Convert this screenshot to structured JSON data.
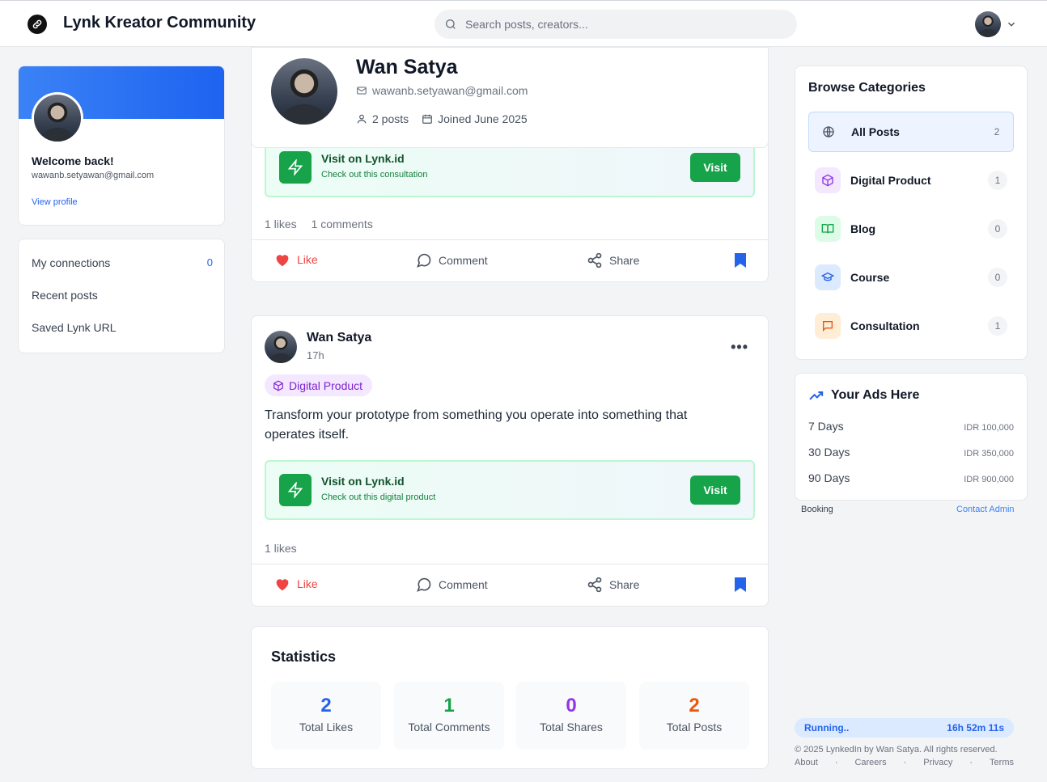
{
  "header": {
    "app_title": "Lynk Kreator Community",
    "search_placeholder": "Search posts, creators..."
  },
  "sidebar": {
    "welcome": "Welcome back!",
    "email": "wawanb.setyawan@gmail.com",
    "view_profile": "View profile",
    "links": [
      {
        "label": "My connections",
        "count": "0"
      },
      {
        "label": "Recent posts"
      },
      {
        "label": "Saved Lynk URL"
      }
    ]
  },
  "profile": {
    "name": "Wan Satya",
    "email": "wawanb.setyawan@gmail.com",
    "posts": "2 posts",
    "joined": "Joined June 2025"
  },
  "posts": [
    {
      "lynk_title": "Visit on Lynk.id",
      "lynk_sub": "Check out this consultation",
      "visit": "Visit",
      "likes": "1 likes",
      "comments": "1 comments"
    },
    {
      "author": "Wan Satya",
      "time": "17h",
      "category": "Digital Product",
      "text": "Transform your prototype from something you operate into something that operates itself.",
      "lynk_title": "Visit on Lynk.id",
      "lynk_sub": "Check out this digital product",
      "visit": "Visit",
      "likes": "1 likes"
    }
  ],
  "actions": {
    "like": "Like",
    "comment": "Comment",
    "share": "Share"
  },
  "statistics": {
    "title": "Statistics",
    "items": [
      {
        "value": "2",
        "label": "Total Likes",
        "color": "#2563eb"
      },
      {
        "value": "1",
        "label": "Total Comments",
        "color": "#16a34a"
      },
      {
        "value": "0",
        "label": "Total Shares",
        "color": "#9333ea"
      },
      {
        "value": "2",
        "label": "Total Posts",
        "color": "#ea580c"
      }
    ]
  },
  "categories": {
    "title": "Browse Categories",
    "items": [
      {
        "label": "All Posts",
        "count": "2",
        "icon": "globe-icon"
      },
      {
        "label": "Digital Product",
        "count": "1",
        "icon": "box-icon"
      },
      {
        "label": "Blog",
        "count": "0",
        "icon": "book-icon"
      },
      {
        "label": "Course",
        "count": "0",
        "icon": "graduation-cap-icon"
      },
      {
        "label": "Consultation",
        "count": "1",
        "icon": "message-square-icon"
      }
    ]
  },
  "ads": {
    "title": "Your Ads Here",
    "rows": [
      {
        "duration": "7 Days",
        "price": "IDR 100,000"
      },
      {
        "duration": "30 Days",
        "price": "IDR 350,000"
      },
      {
        "duration": "90 Days",
        "price": "IDR 900,000"
      }
    ],
    "booking": "Booking",
    "contact": "Contact Admin"
  },
  "footer": {
    "status": "Running..",
    "timer": "16h 52m 11s",
    "copyright": "© 2025 LynkedIn by Wan Satya. All rights reserved.",
    "links": [
      "About",
      "·",
      "Careers",
      "·",
      "Privacy",
      "·",
      "Terms"
    ]
  },
  "colors": {
    "accent": "#2563eb",
    "visit_green": "#16a34a",
    "like_red": "#ef4444"
  }
}
